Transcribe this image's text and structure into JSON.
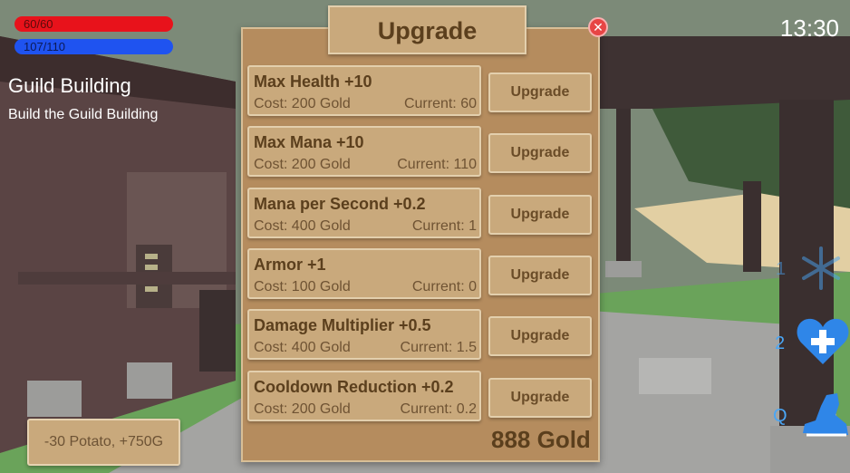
{
  "hud": {
    "health": "60/60",
    "mana": "107/110",
    "health_fraction": 1.0,
    "mana_fraction": 0.9727,
    "clock": "13:30"
  },
  "quest": {
    "title": "Guild Building",
    "description": "Build the Guild Building"
  },
  "notification": "-30 Potato, +750G",
  "upgrade_panel": {
    "title": "Upgrade",
    "close_icon": "close-icon",
    "gold": "888 Gold",
    "items": [
      {
        "name": "Max Health +10",
        "cost": "Cost: 200 Gold",
        "current": "Current: 60",
        "button": "Upgrade"
      },
      {
        "name": "Max Mana +10",
        "cost": "Cost: 200 Gold",
        "current": "Current: 110",
        "button": "Upgrade"
      },
      {
        "name": "Mana per Second +0.2",
        "cost": "Cost: 400 Gold",
        "current": "Current: 1",
        "button": "Upgrade"
      },
      {
        "name": "Armor +1",
        "cost": "Cost: 100 Gold",
        "current": "Current: 0",
        "button": "Upgrade"
      },
      {
        "name": "Damage Multiplier +0.5",
        "cost": "Cost: 400 Gold",
        "current": "Current: 1.5",
        "button": "Upgrade"
      },
      {
        "name": "Cooldown Reduction +0.2",
        "cost": "Cost: 200 Gold",
        "current": "Current: 0.2",
        "button": "Upgrade"
      }
    ]
  },
  "skills": [
    {
      "key": "1",
      "icon": "snowflake-icon"
    },
    {
      "key": "2",
      "icon": "heal-heart-icon"
    },
    {
      "key": "Q",
      "icon": "dash-boot-icon"
    }
  ],
  "colors": {
    "health": "#e8121b",
    "mana": "#1f53f0",
    "panel": "#b58c5e",
    "card": "#c9a97c",
    "skill": "#4aa6f5"
  }
}
